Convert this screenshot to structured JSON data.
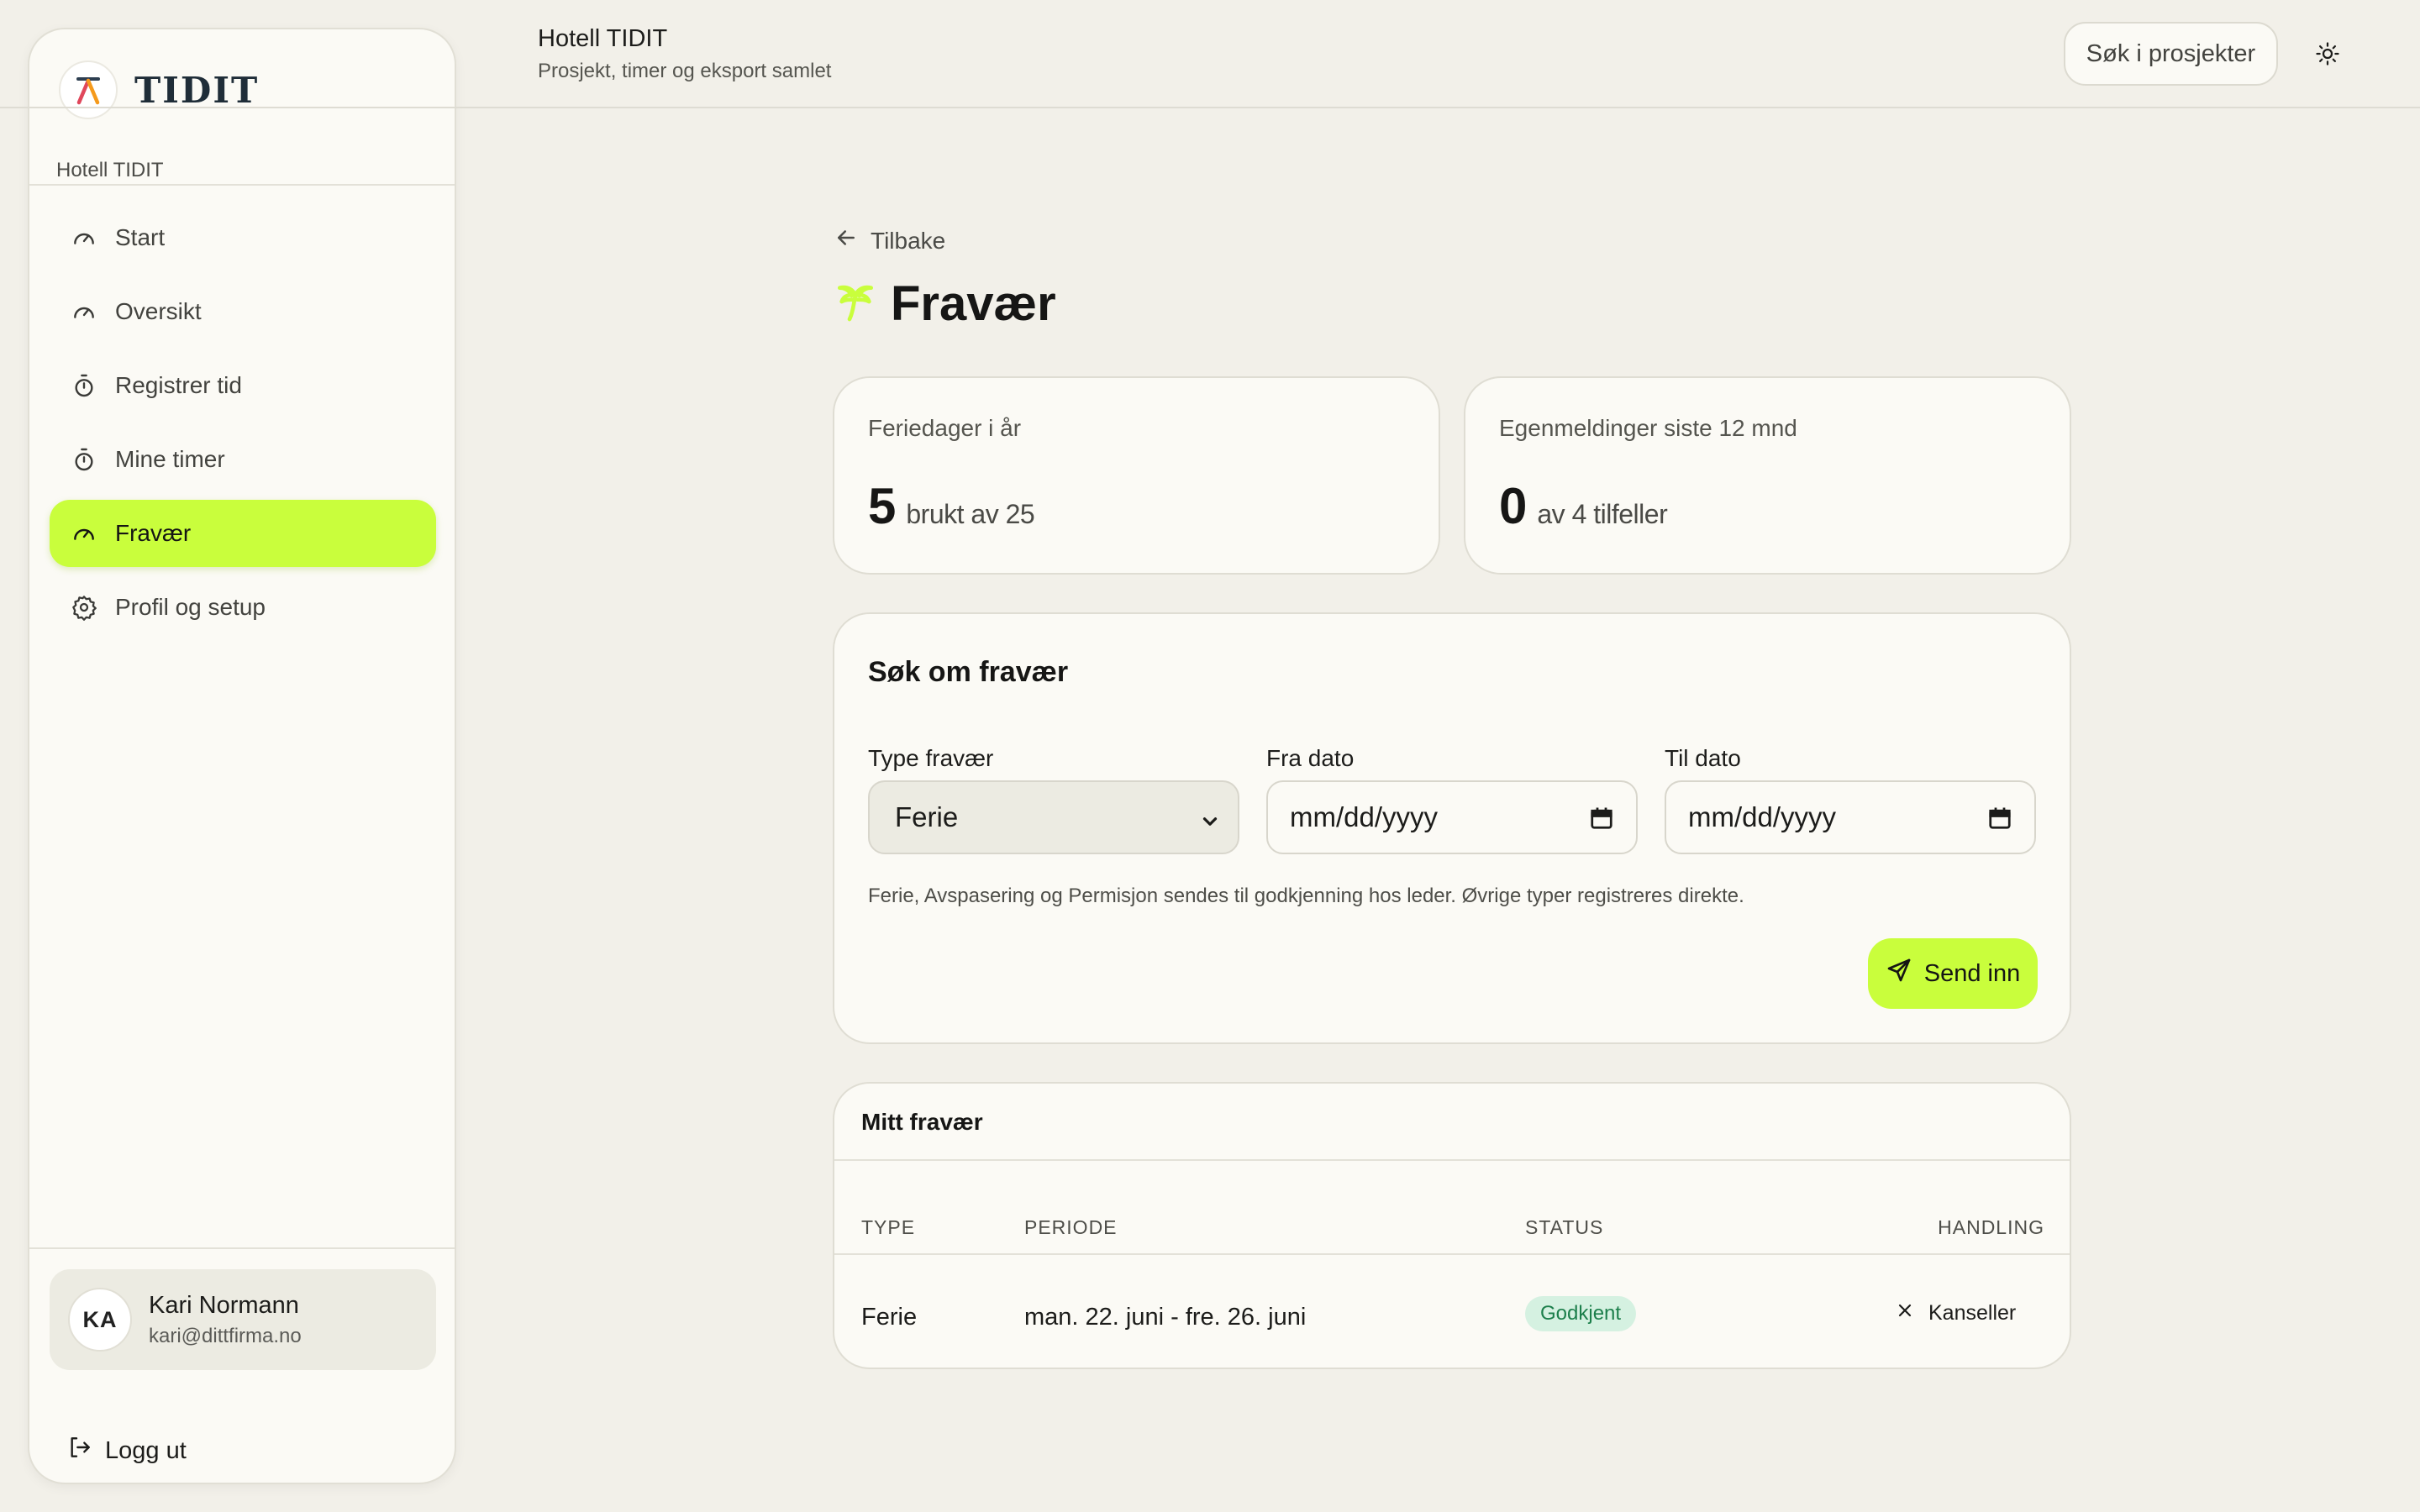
{
  "sidebar": {
    "brand_name": "TIDIT",
    "workspace": "Hotell TIDIT",
    "nav": [
      {
        "label": "Start",
        "icon": "gauge-icon"
      },
      {
        "label": "Oversikt",
        "icon": "gauge-icon"
      },
      {
        "label": "Registrer tid",
        "icon": "stopwatch-icon"
      },
      {
        "label": "Mine timer",
        "icon": "stopwatch-icon"
      },
      {
        "label": "Fravær",
        "icon": "gauge-icon",
        "active": true
      },
      {
        "label": "Profil og setup",
        "icon": "gear-icon"
      }
    ],
    "user": {
      "initials": "KA",
      "name": "Kari Normann",
      "email": "kari@dittfirma.no"
    },
    "logout_label": "Logg ut"
  },
  "header": {
    "title": "Hotell TIDIT",
    "subtitle": "Prosjekt, timer og eksport samlet",
    "search_label": "Søk i prosjekter"
  },
  "main": {
    "back_label": "Tilbake",
    "page_title": "Fravær",
    "stats": [
      {
        "label": "Feriedager i år",
        "value": "5",
        "suffix": "brukt av 25"
      },
      {
        "label": "Egenmeldinger siste 12 mnd",
        "value": "0",
        "suffix": "av 4 tilfeller"
      }
    ],
    "form": {
      "title": "Søk om fravær",
      "type_label": "Type fravær",
      "type_value": "Ferie",
      "from_label": "Fra dato",
      "from_placeholder": "mm/dd/yyyy",
      "to_label": "Til dato",
      "to_placeholder": "mm/dd/yyyy",
      "hint": "Ferie, Avspasering og Permisjon sendes til godkjenning hos leder. Øvrige typer registreres direkte.",
      "submit_label": "Send inn"
    },
    "table": {
      "title": "Mitt fravær",
      "columns": [
        "TYPE",
        "PERIODE",
        "STATUS",
        "HANDLING"
      ],
      "rows": [
        {
          "type": "Ferie",
          "period": "man. 22. juni - fre. 26. juni",
          "status": "Godkjent",
          "action": "Kanseller"
        }
      ]
    }
  },
  "colors": {
    "accent": "#c9fe3c",
    "background": "#f2f0e9",
    "card": "#fbfaf5",
    "status_approved_bg": "#d5f1e1",
    "status_approved_text": "#1c7f4b"
  }
}
